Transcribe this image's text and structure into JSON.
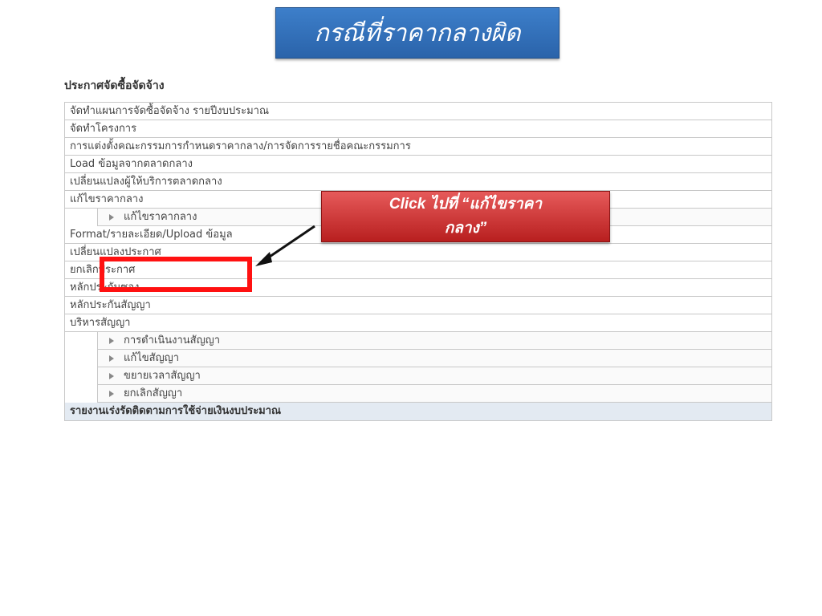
{
  "banner": {
    "title": "กรณีที่ราคากลางผิด"
  },
  "section": {
    "title": "ประกาศจัดซื้อจัดจ้าง"
  },
  "menu": {
    "items": [
      {
        "label": "จัดทำแผนการจัดซื้อจัดจ้าง รายปีงบประมาณ",
        "level": 0
      },
      {
        "label": "จัดทำโครงการ",
        "level": 0
      },
      {
        "label": "การแต่งตั้งคณะกรรมการกำหนดราคากลาง/การจัดการรายชื่อคณะกรรมการ",
        "level": 0
      },
      {
        "label": "Load ข้อมูลจากตลาดกลาง",
        "level": 0
      },
      {
        "label": "เปลี่ยนแปลงผู้ให้บริการตลาดกลาง",
        "level": 0
      },
      {
        "label": "แก้ไขราคากลาง",
        "level": 0
      },
      {
        "label": "แก้ไขราคากลาง",
        "level": 1
      },
      {
        "label": "Format/รายละเอียด/Upload ข้อมูล",
        "level": 0
      },
      {
        "label": "เปลี่ยนแปลงประกาศ",
        "level": 0
      },
      {
        "label": "ยกเลิกประกาศ",
        "level": 0
      },
      {
        "label": "หลักประกันซอง",
        "level": 0
      },
      {
        "label": "หลักประกันสัญญา",
        "level": 0
      },
      {
        "label": "บริหารสัญญา",
        "level": 0
      },
      {
        "label": "การดำเนินงานสัญญา",
        "level": 1
      },
      {
        "label": "แก้ไขสัญญา",
        "level": 1
      },
      {
        "label": "ขยายเวลาสัญญา",
        "level": 1
      },
      {
        "label": "ยกเลิกสัญญา",
        "level": 1
      },
      {
        "label": "รายงานเร่งรัดติดตามการใช้จ่ายเงินงบประมาณ",
        "level": 0,
        "header": true
      }
    ]
  },
  "callout": {
    "line1": "Click ไปที่ “แก้ไขราคา",
    "line2": "กลาง”"
  },
  "colors": {
    "banner": "#2f6db5",
    "callout": "#cc3333",
    "highlight": "#ff1111"
  }
}
